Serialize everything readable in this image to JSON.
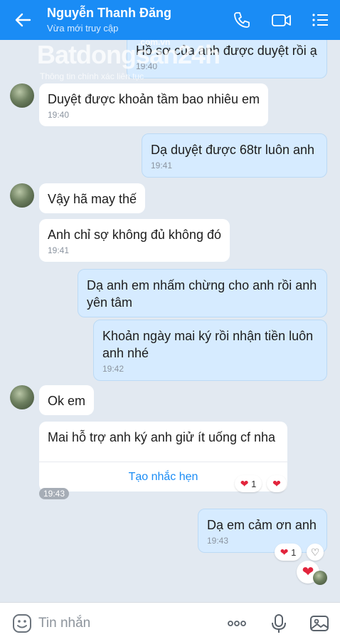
{
  "header": {
    "contact_name": "Nguyễn Thanh Đăng",
    "status": "Vừa mới truy cập"
  },
  "watermark": {
    "brand": "Batdongsan24h",
    "domain": ".com.vn",
    "tagline": "Thông tin chính xác liên tục"
  },
  "messages": [
    {
      "from": "me",
      "text": "Hồ sơ của anh được duyệt rồi ạ",
      "time": "19:40"
    },
    {
      "from": "them",
      "text": "Duyệt được khoản tầm bao nhiêu em",
      "time": "19:40"
    },
    {
      "from": "me",
      "text": "Dạ duyệt được 68tr luôn anh",
      "time": "19:41"
    },
    {
      "from": "them",
      "text": "Vậy hã may thế",
      "time": ""
    },
    {
      "from": "them",
      "text": "Anh chỉ sợ không đủ không đó",
      "time": "19:41"
    },
    {
      "from": "me",
      "text": "Dạ anh em nhấm chừng cho anh rồi anh yên tâm",
      "time": ""
    },
    {
      "from": "me",
      "text": "Khoản ngày mai ký rồi nhận tiền luôn anh nhé",
      "time": "19:42"
    },
    {
      "from": "them",
      "text": "Ok em",
      "time": ""
    },
    {
      "from": "them",
      "text": "Mai hỗ trợ anh ký anh giử ít uống cf nha",
      "time": ""
    },
    {
      "from": "me",
      "text": "Dạ em cảm ơn anh",
      "time": "19:43"
    }
  ],
  "reminder_label": "Tạo nhắc hẹn",
  "group_time": "19:43",
  "reactions": {
    "heart_count_1": "1",
    "heart_count_2": "1",
    "heart_color": "#e2243c"
  },
  "composer": {
    "placeholder": "Tin nhắn"
  },
  "colors": {
    "header": "#1a8cf5",
    "background": "#e2e9f1",
    "outgoing_bubble": "#d6ebff",
    "incoming_bubble": "#ffffff",
    "link": "#1a8cf5"
  },
  "icons": [
    "back-arrow-icon",
    "phone-icon",
    "video-call-icon",
    "menu-list-icon",
    "sticker-icon",
    "more-icon",
    "microphone-icon",
    "image-icon",
    "heart-icon",
    "heart-outline-icon"
  ]
}
